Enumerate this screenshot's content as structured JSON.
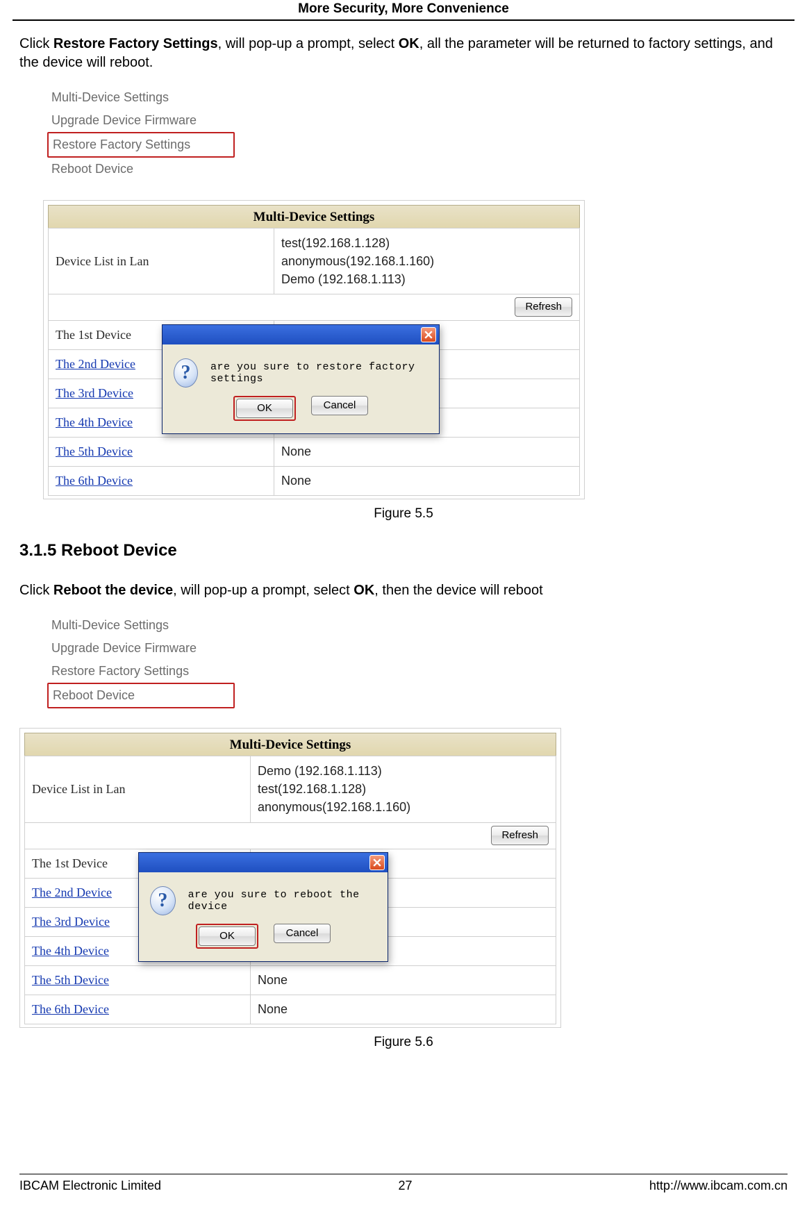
{
  "header": {
    "title": "More Security, More Convenience"
  },
  "section1": {
    "intro_pre": "Click ",
    "intro_bold1": "Restore Factory Settings",
    "intro_mid": ", will pop-up a prompt, select ",
    "intro_bold2": "OK",
    "intro_post": ", all the parameter will be returned to factory settings, and the device will reboot.",
    "menu": {
      "items": [
        "Multi-Device Settings",
        "Upgrade Device Firmware",
        "Restore Factory Settings",
        "Reboot Device"
      ],
      "highlight_index": 2
    },
    "panel": {
      "title": "Multi-Device Settings",
      "lan_label": "Device List in Lan",
      "lan_values": "test(192.168.1.128)\nanonymous(192.168.1.160)\nDemo (192.168.1.113)",
      "refresh_label": "Refresh",
      "rows": [
        {
          "label": "The 1st Device",
          "value": "",
          "link": false
        },
        {
          "label": "The 2nd Device",
          "value": "",
          "link": true
        },
        {
          "label": "The 3rd Device",
          "value": "",
          "link": true
        },
        {
          "label": "The 4th Device",
          "value": "",
          "link": true
        },
        {
          "label": "The 5th Device",
          "value": "None",
          "link": true
        },
        {
          "label": "The 6th Device",
          "value": "None",
          "link": true
        }
      ]
    },
    "dialog": {
      "message": "are you sure to restore factory settings",
      "ok_label": "OK",
      "cancel_label": "Cancel"
    },
    "caption": "Figure 5.5"
  },
  "section2": {
    "heading": "3.1.5 Reboot Device",
    "intro_pre": "Click ",
    "intro_bold1": "Reboot the device",
    "intro_mid": ", will pop-up a prompt, select ",
    "intro_bold2": "OK",
    "intro_post": ", then the device will reboot",
    "menu": {
      "items": [
        "Multi-Device Settings",
        "Upgrade Device Firmware",
        "Restore Factory Settings",
        "Reboot Device"
      ],
      "highlight_index": 3
    },
    "panel": {
      "title": "Multi-Device Settings",
      "lan_label": "Device List in Lan",
      "lan_values": "Demo (192.168.1.113)\ntest(192.168.1.128)\nanonymous(192.168.1.160)",
      "refresh_label": "Refresh",
      "rows": [
        {
          "label": "The 1st Device",
          "value": "",
          "link": false
        },
        {
          "label": "The 2nd Device",
          "value": "",
          "link": true
        },
        {
          "label": "The 3rd Device",
          "value": "",
          "link": true
        },
        {
          "label": "The 4th Device",
          "value": "",
          "link": true
        },
        {
          "label": "The 5th Device",
          "value": "None",
          "link": true
        },
        {
          "label": "The 6th Device",
          "value": "None",
          "link": true
        }
      ]
    },
    "dialog": {
      "message": "are you sure to reboot the device",
      "ok_label": "OK",
      "cancel_label": "Cancel"
    },
    "caption": "Figure 5.6"
  },
  "footer": {
    "left": "IBCAM Electronic Limited",
    "center": "27",
    "right": "http://www.ibcam.com.cn"
  }
}
